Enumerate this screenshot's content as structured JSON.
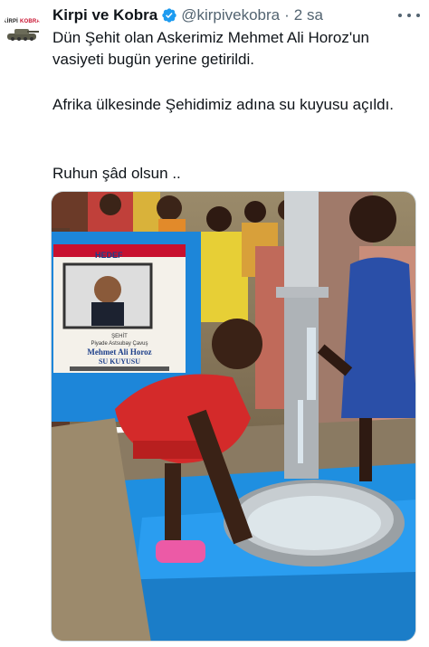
{
  "account": {
    "display_name": "Kirpi ve Kobra",
    "handle": "@kirpivekobra",
    "separator": "·",
    "time": "2 sa",
    "avatar_logo_a": "KİRPİ",
    "avatar_logo_b": "KOBRA"
  },
  "tweet": {
    "paragraph1": "Dün Şehit olan Askerimiz Mehmet Ali Horoz'un vasiyeti bugün yerine getirildi.",
    "paragraph2": "Afrika ülkesinde Şehidimiz adına su kuyusu açıldı.",
    "paragraph3": "Ruhun şâd olsun .."
  },
  "media": {
    "plaque_top": "HEDEF",
    "plaque_line1": "ŞEHİT",
    "plaque_line2": "Piyade Astsubay Çavuş",
    "plaque_line3": "Mehmet Ali Horoz",
    "plaque_line4": "SU KUYUSU"
  },
  "colors": {
    "verified": "#1d9bf0",
    "text_primary": "#0f1419",
    "text_secondary": "#536471",
    "well_blue": "#1f8fe0"
  },
  "icons": [
    "verified-badge-icon",
    "more-options-icon"
  ]
}
